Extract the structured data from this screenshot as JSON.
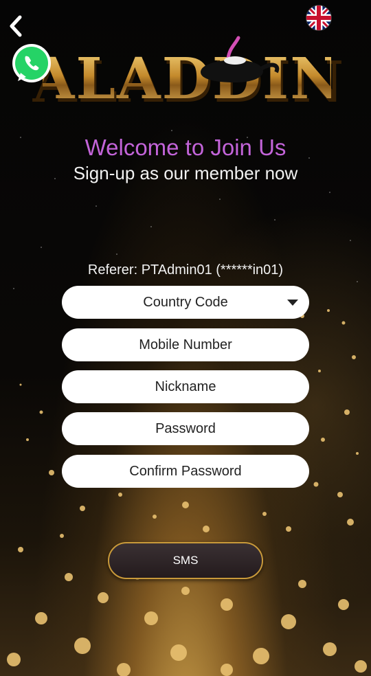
{
  "header": {
    "back_icon": "chevron-left-icon",
    "language_icon": "uk-flag-icon",
    "whatsapp_icon": "whatsapp-icon"
  },
  "logo_text": "ALADDIN",
  "welcome": {
    "title": "Welcome to Join Us",
    "subtitle": "Sign-up as our member now"
  },
  "form": {
    "referer": "Referer: PTAdmin01 (******in01)",
    "country_code_placeholder": "Country Code",
    "mobile_placeholder": "Mobile Number",
    "nickname_placeholder": "Nickname",
    "password_placeholder": "Password",
    "confirm_password_placeholder": "Confirm Password",
    "sms_button": "SMS"
  },
  "colors": {
    "title": "#c364d9",
    "button_border": "#c99a3a"
  }
}
